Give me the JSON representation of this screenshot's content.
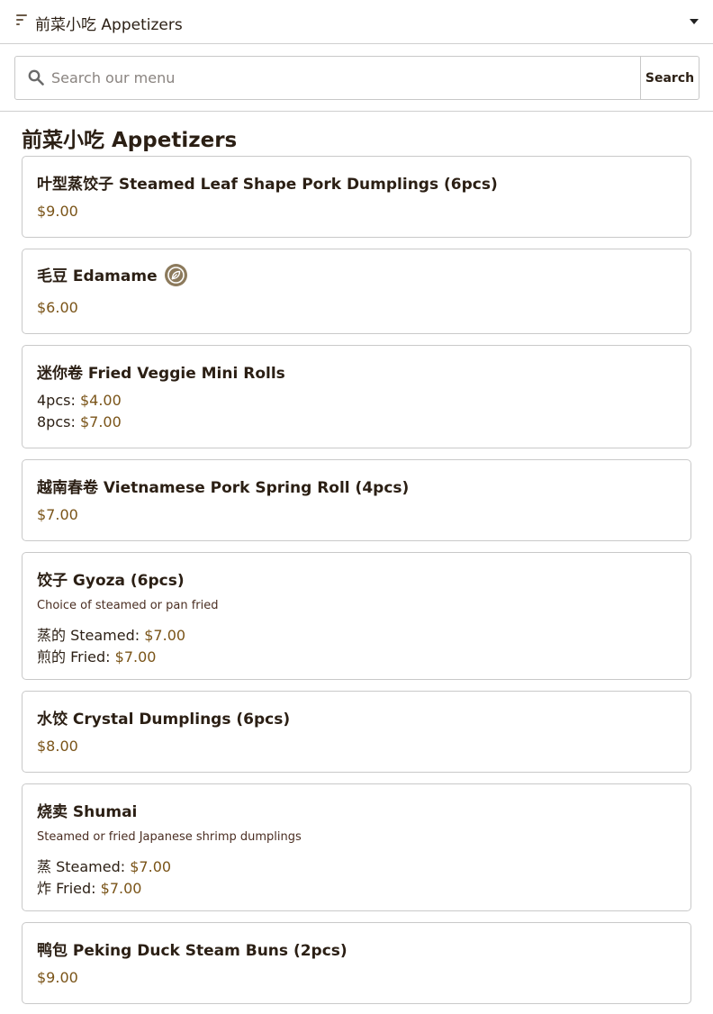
{
  "header": {
    "title": "前菜小吃 Appetizers"
  },
  "search": {
    "placeholder": "Search our menu",
    "button_label": "Search"
  },
  "section": {
    "title": "前菜小吃 Appetizers"
  },
  "items": [
    {
      "name": "叶型蒸饺子 Steamed Leaf Shape Pork Dumplings (6pcs)",
      "price": "$9.00"
    },
    {
      "name": "毛豆 Edamame",
      "price": "$6.00",
      "badge_icon": "vegan-leaf-icon"
    },
    {
      "name": "迷你卷 Fried Veggie Mini Rolls",
      "options": [
        {
          "label": "4pcs:",
          "price": "$4.00"
        },
        {
          "label": "8pcs:",
          "price": "$7.00"
        }
      ]
    },
    {
      "name": "越南春卷 Vietnamese Pork Spring Roll (4pcs)",
      "price": "$7.00"
    },
    {
      "name": "饺子 Gyoza (6pcs)",
      "description": "Choice of steamed or pan fried",
      "options": [
        {
          "label": "蒸的 Steamed:",
          "price": "$7.00"
        },
        {
          "label": "煎的 Fried:",
          "price": "$7.00"
        }
      ]
    },
    {
      "name": "水饺 Crystal Dumplings (6pcs)",
      "price": "$8.00"
    },
    {
      "name": "烧卖 Shumai",
      "description": "Steamed or fried Japanese shrimp dumplings",
      "options": [
        {
          "label": "蒸 Steamed:",
          "price": "$7.00"
        },
        {
          "label": "炸 Fried:",
          "price": "$7.00"
        }
      ]
    },
    {
      "name": "鸭包 Peking Duck Steam Buns (2pcs)",
      "price": "$9.00"
    }
  ],
  "colors": {
    "price": "#7a5418",
    "text": "#2b1f14",
    "badge": "#8c7a5c",
    "border": "#c9c9c9"
  }
}
